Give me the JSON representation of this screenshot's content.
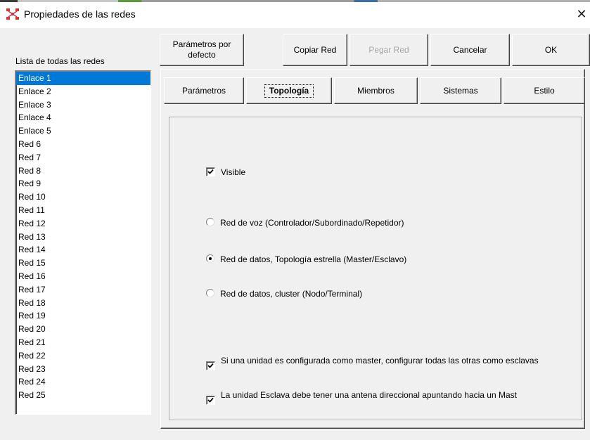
{
  "window": {
    "title": "Propiedades de las redes",
    "close_glyph": "✕"
  },
  "list": {
    "label": "Lista de todas las redes",
    "items": [
      "Enlace 1",
      "Enlace 2",
      "Enlace 3",
      "Enlace 4",
      "Enlace 5",
      "Red  6",
      "Red  7",
      "Red  8",
      "Red  9",
      "Red 10",
      "Red 11",
      "Red 12",
      "Red 13",
      "Red 14",
      "Red 15",
      "Red 16",
      "Red 17",
      "Red 18",
      "Red 19",
      "Red 20",
      "Red 21",
      "Red 22",
      "Red 23",
      "Red 24",
      "Red 25"
    ],
    "selected_index": 0
  },
  "toolbar": {
    "defaults": "Parámetros por\ndefecto",
    "copy": "Copiar Red",
    "paste": "Pegar Red",
    "cancel": "Cancelar",
    "ok": "OK"
  },
  "tabs": [
    "Parámetros",
    "Topología",
    "Miembros",
    "Sistemas",
    "Estilo"
  ],
  "active_tab": 1,
  "topology": {
    "visible_label": "Visible",
    "visible_checked": true,
    "radio_voice": "Red de voz (Controlador/Subordinado/Repetidor)",
    "radio_star": "Red de datos, Topología estrella (Master/Esclavo)",
    "radio_cluster": "Red de datos, cluster (Nodo/Terminal)",
    "selected_radio": "star",
    "opt_master": "Si una unidad es configurada como master, configurar todas las otras como esclavas",
    "opt_master_checked": true,
    "opt_antenna": "La unidad Esclava debe tener una antena direccional apuntando hacia un Mast",
    "opt_antenna_checked": true
  },
  "colors": {
    "selection": "#0078d7",
    "face": "#f0f0f0"
  }
}
